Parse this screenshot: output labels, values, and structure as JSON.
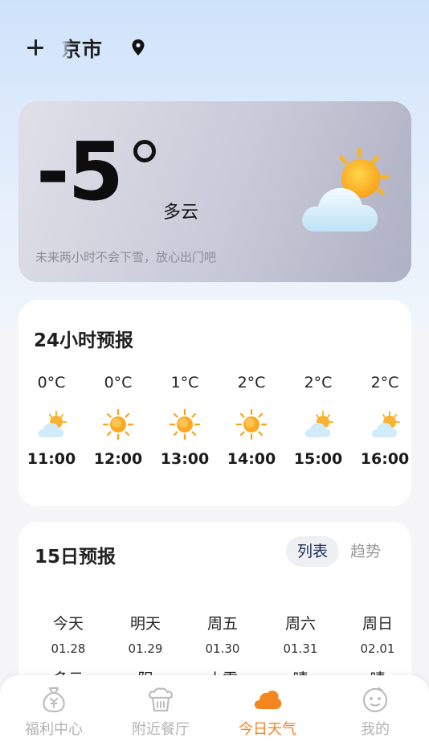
{
  "header": {
    "city": "京市",
    "add_icon": "plus-icon",
    "location_icon": "location-pin-icon"
  },
  "current": {
    "temperature": "-5",
    "condition": "多云",
    "hint": "未来两小时不会下雪，放心出门吧",
    "icon": "partly-cloudy-icon"
  },
  "hourly": {
    "title": "24小时预报",
    "items": [
      {
        "temp": "0°C",
        "time": "11:00",
        "icon": "partly-cloudy-icon"
      },
      {
        "temp": "0°C",
        "time": "12:00",
        "icon": "sun-icon"
      },
      {
        "temp": "1°C",
        "time": "13:00",
        "icon": "sun-icon"
      },
      {
        "temp": "2°C",
        "time": "14:00",
        "icon": "sun-icon"
      },
      {
        "temp": "2°C",
        "time": "15:00",
        "icon": "partly-cloudy-icon"
      },
      {
        "temp": "2°C",
        "time": "16:00",
        "icon": "partly-cloudy-icon"
      }
    ]
  },
  "daily": {
    "title": "15日预报",
    "toggle": {
      "list": "列表",
      "trend": "趋势",
      "active": "list"
    },
    "items": [
      {
        "day": "今天",
        "date": "01.28",
        "cond": "多云"
      },
      {
        "day": "明天",
        "date": "01.29",
        "cond": "阴"
      },
      {
        "day": "周五",
        "date": "01.30",
        "cond": "小雪"
      },
      {
        "day": "周六",
        "date": "01.31",
        "cond": "晴"
      },
      {
        "day": "周日",
        "date": "02.01",
        "cond": "晴"
      }
    ]
  },
  "tabbar": {
    "items": [
      {
        "label": "福利中心",
        "icon": "money-bag-icon"
      },
      {
        "label": "附近餐厅",
        "icon": "restaurant-icon"
      },
      {
        "label": "今日天气",
        "icon": "cloud-icon",
        "active": true
      },
      {
        "label": "我的",
        "icon": "smiley-face-icon"
      }
    ]
  },
  "colors": {
    "accent": "#f5851f",
    "inactive_tab": "#b3b3b3"
  }
}
